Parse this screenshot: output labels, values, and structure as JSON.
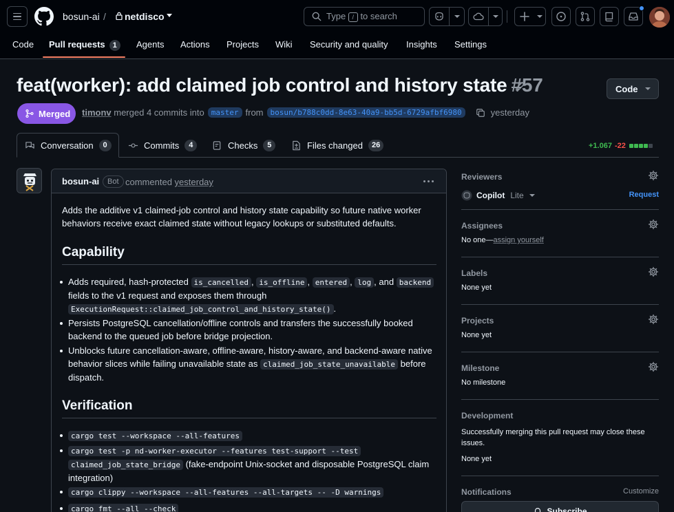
{
  "header": {
    "owner": "bosun-ai",
    "slash": "/",
    "repo": "netdisco",
    "search_text": "Type",
    "search_key": "/",
    "search_suffix": "to search"
  },
  "repo_nav": {
    "items": [
      {
        "label": "Code"
      },
      {
        "label": "Pull requests",
        "count": "1"
      },
      {
        "label": "Agents"
      },
      {
        "label": "Actions"
      },
      {
        "label": "Projects"
      },
      {
        "label": "Wiki"
      },
      {
        "label": "Security and quality"
      },
      {
        "label": "Insights"
      },
      {
        "label": "Settings"
      }
    ]
  },
  "pr": {
    "title": "feat(worker): add claimed job control and history state",
    "number": "#57",
    "code_button": "Code",
    "state": "Merged",
    "author": "timonv",
    "action": "merged 4 commits into",
    "base_branch": "master",
    "from_word": "from",
    "head_branch": "bosun/b788c0dd-8e63-40a9-bb5d-6729afbf6980",
    "when": "yesterday"
  },
  "tabs": [
    {
      "label": "Conversation",
      "count": "0"
    },
    {
      "label": "Commits",
      "count": "4"
    },
    {
      "label": "Checks",
      "count": "5"
    },
    {
      "label": "Files changed",
      "count": "26"
    }
  ],
  "diffstat": {
    "additions": "+1.067",
    "deletions": "-22",
    "colors": [
      "#3fb950",
      "#3fb950",
      "#3fb950",
      "#3fb950",
      "#3d444d"
    ]
  },
  "comment": {
    "author": "bosun-ai",
    "badge": "Bot",
    "action": "commented",
    "time": "yesterday",
    "intro": "Adds the additive v1 claimed-job control and history state capability so future native worker behaviors receive exact claimed state without legacy lookups or substituted defaults.",
    "capability_heading": "Capability",
    "cap1_a": "Adds required, hash-protected",
    "cap1_c1": "is_cancelled",
    "cap1_c2": "is_offline",
    "cap1_c3": "entered",
    "cap1_c4": "log",
    "cap1_and": ", and",
    "cap1_c5": "backend",
    "cap1_b": "fields to the v1 request and exposes them through",
    "cap1_c6": "ExecutionRequest::claimed_job_control_and_history_state()",
    "cap2": "Persists PostgreSQL cancellation/offline controls and transfers the successfully booked backend to the queued job before bridge projection.",
    "cap3_a": "Unblocks future cancellation-aware, offline-aware, history-aware, and backend-aware native behavior slices while failing unavailable state as",
    "cap3_c": "claimed_job_state_unavailable",
    "cap3_b": "before dispatch.",
    "verification_heading": "Verification",
    "v1": "cargo test --workspace --all-features",
    "v2_c1": "cargo test -p nd-worker-executor --features test-support --test",
    "v2_c2": "claimed_job_state_bridge",
    "v2_text": "(fake-endpoint Unix-socket and disposable PostgreSQL claim integration)",
    "v3": "cargo clippy --workspace --all-features --all-targets -- -D warnings",
    "v4": "cargo fmt --all --check"
  },
  "sidebar": {
    "reviewers_label": "Reviewers",
    "reviewer_name": "Copilot",
    "reviewer_tier": "Lite",
    "request_link": "Request",
    "assignees_label": "Assignees",
    "assignees_value": "No one—",
    "assign_yourself": "assign yourself",
    "labels_label": "Labels",
    "labels_value": "None yet",
    "projects_label": "Projects",
    "projects_value": "None yet",
    "milestone_label": "Milestone",
    "milestone_value": "No milestone",
    "development_label": "Development",
    "development_text": "Successfully merging this pull request may close these issues.",
    "development_value": "None yet",
    "notifications_label": "Notifications",
    "customize": "Customize",
    "subscribe": "Subscribe"
  }
}
